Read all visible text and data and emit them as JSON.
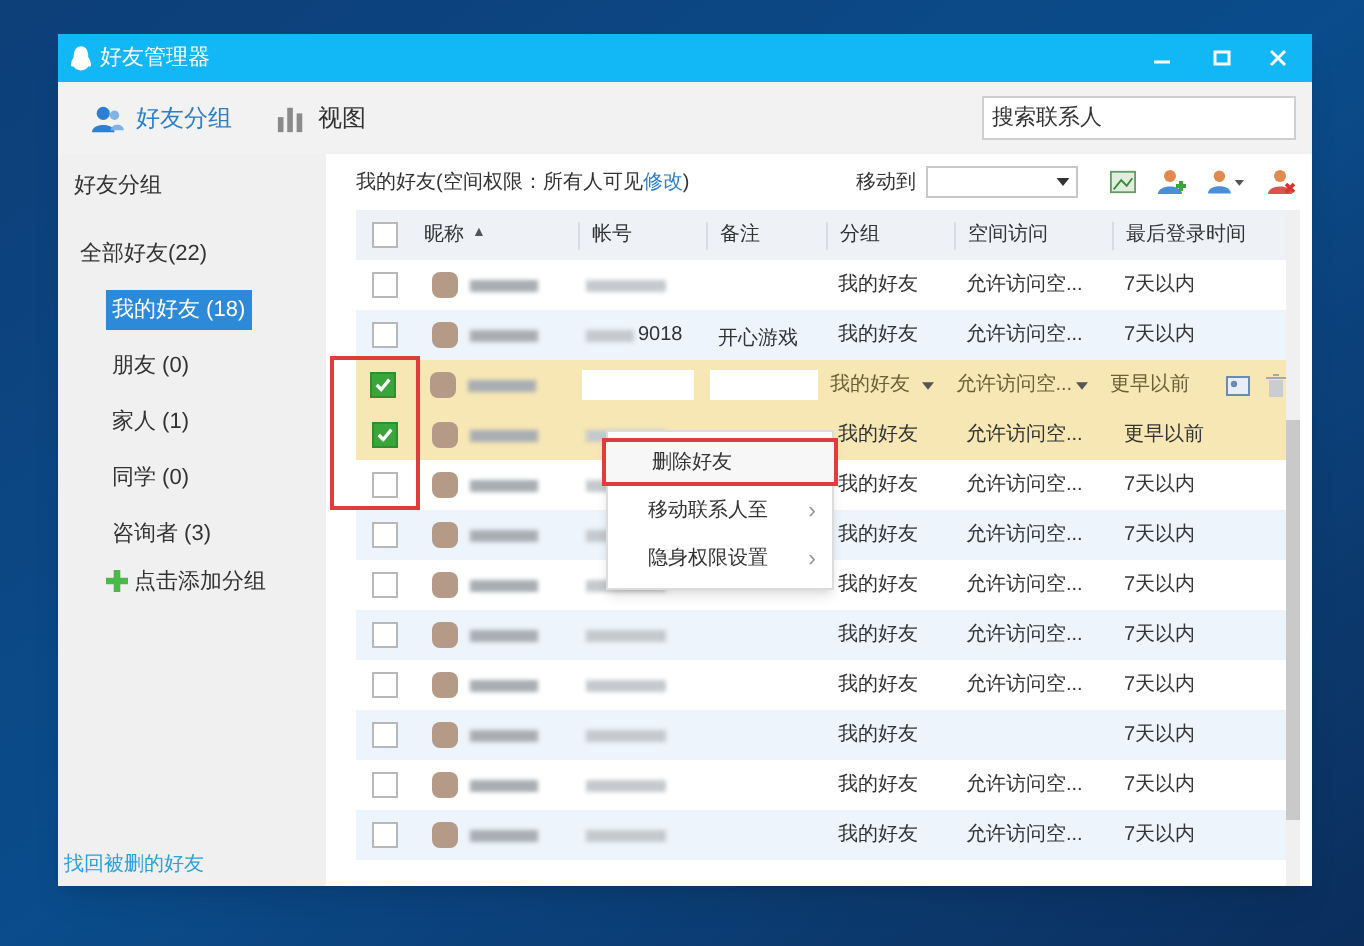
{
  "window": {
    "title": "好友管理器"
  },
  "toolbar": {
    "tabs": [
      {
        "label": "好友分组",
        "selected": true,
        "kind": "groups"
      },
      {
        "label": "视图",
        "selected": false,
        "kind": "chart"
      }
    ],
    "search": {
      "placeholder": "搜索联系人"
    }
  },
  "sidebar": {
    "title": "好友分组",
    "tree": [
      {
        "label": "全部好友(22)",
        "selected": false,
        "children": [
          {
            "label": "我的好友 (18)",
            "selected": true
          },
          {
            "label": "朋友 (0)",
            "selected": false
          },
          {
            "label": "家人 (1)",
            "selected": false
          },
          {
            "label": "同学 (0)",
            "selected": false
          },
          {
            "label": "咨询者 (3)",
            "selected": false
          }
        ]
      }
    ],
    "add_group": "点击添加分组",
    "footer_link": "找回被删的好友"
  },
  "list_header": {
    "prefix": "我的好友(空间权限：所有人可见",
    "link": "修改",
    "suffix": ")",
    "move_to_label": "移动到"
  },
  "table": {
    "select_all_checked": false,
    "columns": [
      "昵称",
      "帐号",
      "备注",
      "分组",
      "空间访问",
      "最后登录时间"
    ],
    "sort_mark": "▲",
    "rows": [
      {
        "checked": false,
        "kind": "normal",
        "account": "",
        "remark": "",
        "group": "我的好友",
        "access": "允许访问空...",
        "last_login": "7天以内"
      },
      {
        "checked": false,
        "kind": "normal",
        "account": "9018",
        "remark": "开心游戏",
        "group": "我的好友",
        "access": "允许访问空...",
        "last_login": "7天以内"
      },
      {
        "checked": true,
        "kind": "editing",
        "account": "",
        "remark": "",
        "group": "我的好友",
        "access": "允许访问空...",
        "last_login": "更早以前"
      },
      {
        "checked": true,
        "kind": "normal",
        "account": "",
        "remark": "",
        "group": "我的好友",
        "access": "允许访问空...",
        "last_login": "更早以前"
      },
      {
        "checked": false,
        "kind": "normal",
        "account": "",
        "remark": "",
        "group": "我的好友",
        "access": "允许访问空...",
        "last_login": "7天以内"
      },
      {
        "checked": false,
        "kind": "normal",
        "account": "",
        "remark": "",
        "group": "我的好友",
        "access": "允许访问空...",
        "last_login": "7天以内"
      },
      {
        "checked": false,
        "kind": "normal",
        "account": "",
        "remark": "",
        "group": "我的好友",
        "access": "允许访问空...",
        "last_login": "7天以内"
      },
      {
        "checked": false,
        "kind": "normal",
        "account": "",
        "remark": "",
        "group": "我的好友",
        "access": "允许访问空...",
        "last_login": "7天以内"
      },
      {
        "checked": false,
        "kind": "normal",
        "account": "",
        "remark": "",
        "group": "我的好友",
        "access": "允许访问空...",
        "last_login": "7天以内"
      },
      {
        "checked": false,
        "kind": "normal",
        "account": "",
        "remark": "",
        "group": "我的好友",
        "access": "",
        "last_login": "7天以内"
      },
      {
        "checked": false,
        "kind": "normal",
        "account": "",
        "remark": "",
        "group": "我的好友",
        "access": "允许访问空...",
        "last_login": "7天以内"
      },
      {
        "checked": false,
        "kind": "normal",
        "account": "",
        "remark": "",
        "group": "我的好友",
        "access": "允许访问空...",
        "last_login": "7天以内"
      }
    ]
  },
  "context_menu": {
    "items": [
      {
        "label": "删除好友",
        "selected": true,
        "submenu": false
      },
      {
        "label": "移动联系人至",
        "selected": false,
        "submenu": true
      },
      {
        "label": "隐身权限设置",
        "selected": false,
        "submenu": true
      }
    ],
    "submenu_mark": "›"
  }
}
